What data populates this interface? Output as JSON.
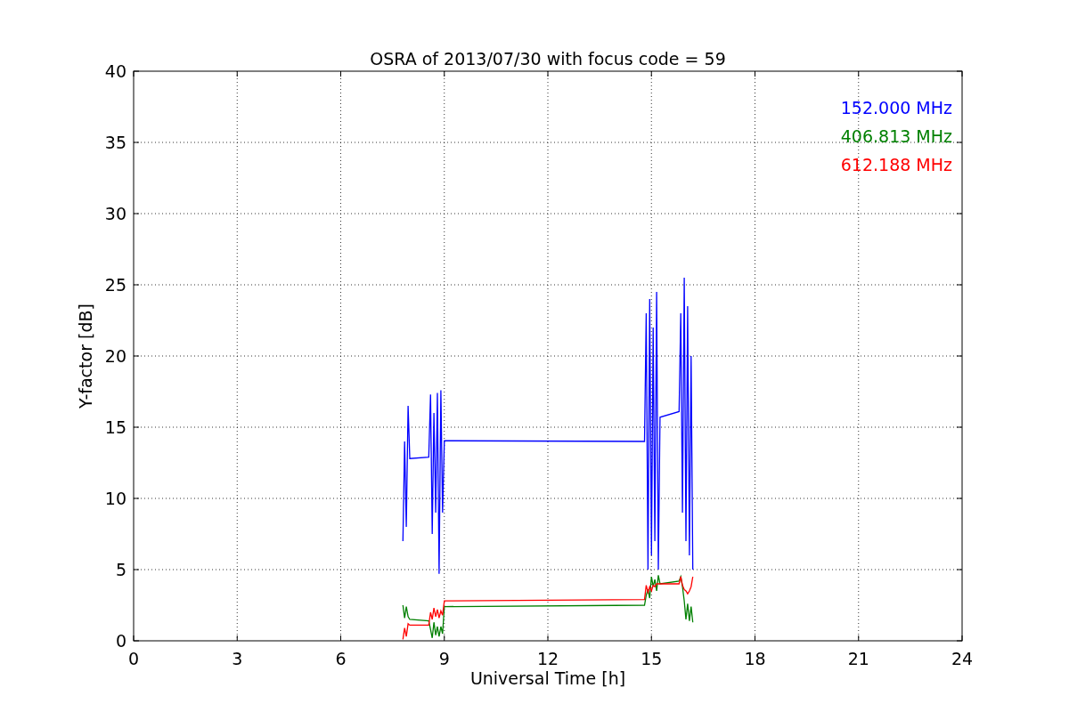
{
  "figure": {
    "chart_data": {
      "type": "line",
      "title": "OSRA of 2013/07/30 with focus code = 59",
      "xlabel": "Universal Time [h]",
      "ylabel": "Y-factor [dB]",
      "xlim": [
        0,
        24
      ],
      "ylim": [
        0,
        40
      ],
      "xticks": [
        0,
        3,
        6,
        9,
        12,
        15,
        18,
        21,
        24
      ],
      "yticks": [
        0,
        5,
        10,
        15,
        20,
        25,
        30,
        35,
        40
      ],
      "grid": true,
      "x": [
        7.8,
        7.85,
        7.9,
        7.95,
        8.0,
        8.55,
        8.6,
        8.65,
        8.7,
        8.75,
        8.8,
        8.85,
        8.9,
        8.95,
        9.0,
        14.8,
        14.85,
        14.9,
        14.95,
        15.0,
        15.05,
        15.1,
        15.15,
        15.2,
        15.25,
        15.8,
        15.85,
        15.9,
        15.95,
        16.0,
        16.05,
        16.1,
        16.15,
        16.2
      ],
      "series": [
        {
          "name": "152.000 MHz",
          "color": "#0000ff",
          "values": [
            7,
            14,
            8,
            16.5,
            12.8,
            12.9,
            17.3,
            7.5,
            16,
            9,
            17.4,
            4.7,
            17.6,
            9,
            14.05,
            14.0,
            23,
            5,
            24,
            6,
            22,
            7,
            24.5,
            5,
            15.7,
            16.1,
            23,
            9,
            25.5,
            7,
            23.5,
            6,
            20,
            5
          ]
        },
        {
          "name": "406.813 MHz",
          "color": "#008000",
          "values": [
            2.5,
            1.6,
            2.4,
            1.7,
            1.5,
            1.4,
            0.8,
            0.2,
            1.3,
            0.4,
            1.0,
            0.3,
            1.0,
            0.5,
            2.4,
            2.5,
            3.2,
            3.6,
            3.0,
            4.5,
            3.8,
            4.3,
            3.5,
            4.6,
            4.0,
            4.2,
            4.5,
            3.8,
            2.8,
            1.5,
            2.6,
            1.4,
            2.4,
            1.3
          ]
        },
        {
          "name": "612.188 MHz",
          "color": "#ff0000",
          "values": [
            0.1,
            0.9,
            0.3,
            1.2,
            1.1,
            1.1,
            2.0,
            1.5,
            2.3,
            1.7,
            2.2,
            1.6,
            2.1,
            1.8,
            2.8,
            2.9,
            3.9,
            3.4,
            3.8,
            3.5,
            3.9,
            3.8,
            4.0,
            4.0,
            4.0,
            4.0,
            4.5,
            3.9,
            3.6,
            3.5,
            3.3,
            3.5,
            3.8,
            4.5
          ]
        }
      ]
    }
  }
}
